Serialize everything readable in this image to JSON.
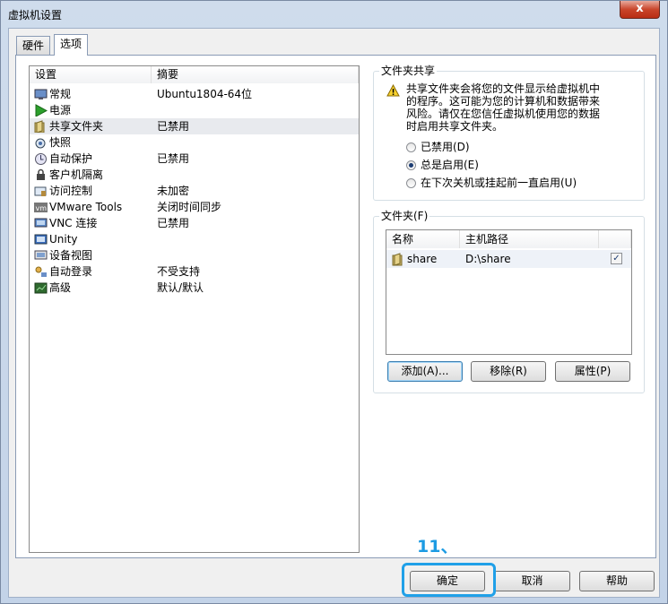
{
  "window": {
    "title": "虚拟机设置",
    "close_symbol": "x"
  },
  "tabs": [
    {
      "label": "硬件",
      "active": false
    },
    {
      "label": "选项",
      "active": true
    }
  ],
  "settings_list": {
    "col_setting": "设置",
    "col_summary": "摘要",
    "rows": [
      {
        "name": "常规",
        "summary": "Ubuntu1804-64位",
        "icon": "monitor-icon"
      },
      {
        "name": "电源",
        "summary": "",
        "icon": "power-play-icon"
      },
      {
        "name": "共享文件夹",
        "summary": "已禁用",
        "icon": "shared-folder-icon"
      },
      {
        "name": "快照",
        "summary": "",
        "icon": "snapshot-icon"
      },
      {
        "name": "自动保护",
        "summary": "已禁用",
        "icon": "autoprotect-icon"
      },
      {
        "name": "客户机隔离",
        "summary": "",
        "icon": "lock-icon"
      },
      {
        "name": "访问控制",
        "summary": "未加密",
        "icon": "access-control-icon"
      },
      {
        "name": "VMware Tools",
        "summary": "关闭时间同步",
        "icon": "vmware-tools-icon"
      },
      {
        "name": "VNC 连接",
        "summary": "已禁用",
        "icon": "vnc-icon"
      },
      {
        "name": "Unity",
        "summary": "",
        "icon": "unity-icon"
      },
      {
        "name": "设备视图",
        "summary": "",
        "icon": "device-view-icon"
      },
      {
        "name": "自动登录",
        "summary": "不受支持",
        "icon": "autologin-icon"
      },
      {
        "name": "高级",
        "summary": "默认/默认",
        "icon": "advanced-icon"
      }
    ]
  },
  "folder_sharing": {
    "title": "文件夹共享",
    "warning_lines": [
      "共享文件夹会将您的文件显示给虚拟机中",
      "的程序。这可能为您的计算机和数据带来",
      "风险。请仅在您信任虚拟机使用您的数据",
      "时启用共享文件夹。"
    ],
    "options": [
      {
        "label": "已禁用(D)",
        "selected": false
      },
      {
        "label": "总是启用(E)",
        "selected": true
      },
      {
        "label": "在下次关机或挂起前一直启用(U)",
        "selected": false
      }
    ]
  },
  "folders": {
    "title": "文件夹(F)",
    "col_name": "名称",
    "col_path": "主机路径",
    "rows": [
      {
        "name": "share",
        "path": "D:\\share",
        "enabled": true
      }
    ],
    "add_label": "添加(A)...",
    "remove_label": "移除(R)",
    "properties_label": "属性(P)"
  },
  "footer": {
    "ok_label": "确定",
    "cancel_label": "取消",
    "help_label": "帮助"
  },
  "annotation": {
    "text": "11、",
    "color": "#20a0e8"
  }
}
